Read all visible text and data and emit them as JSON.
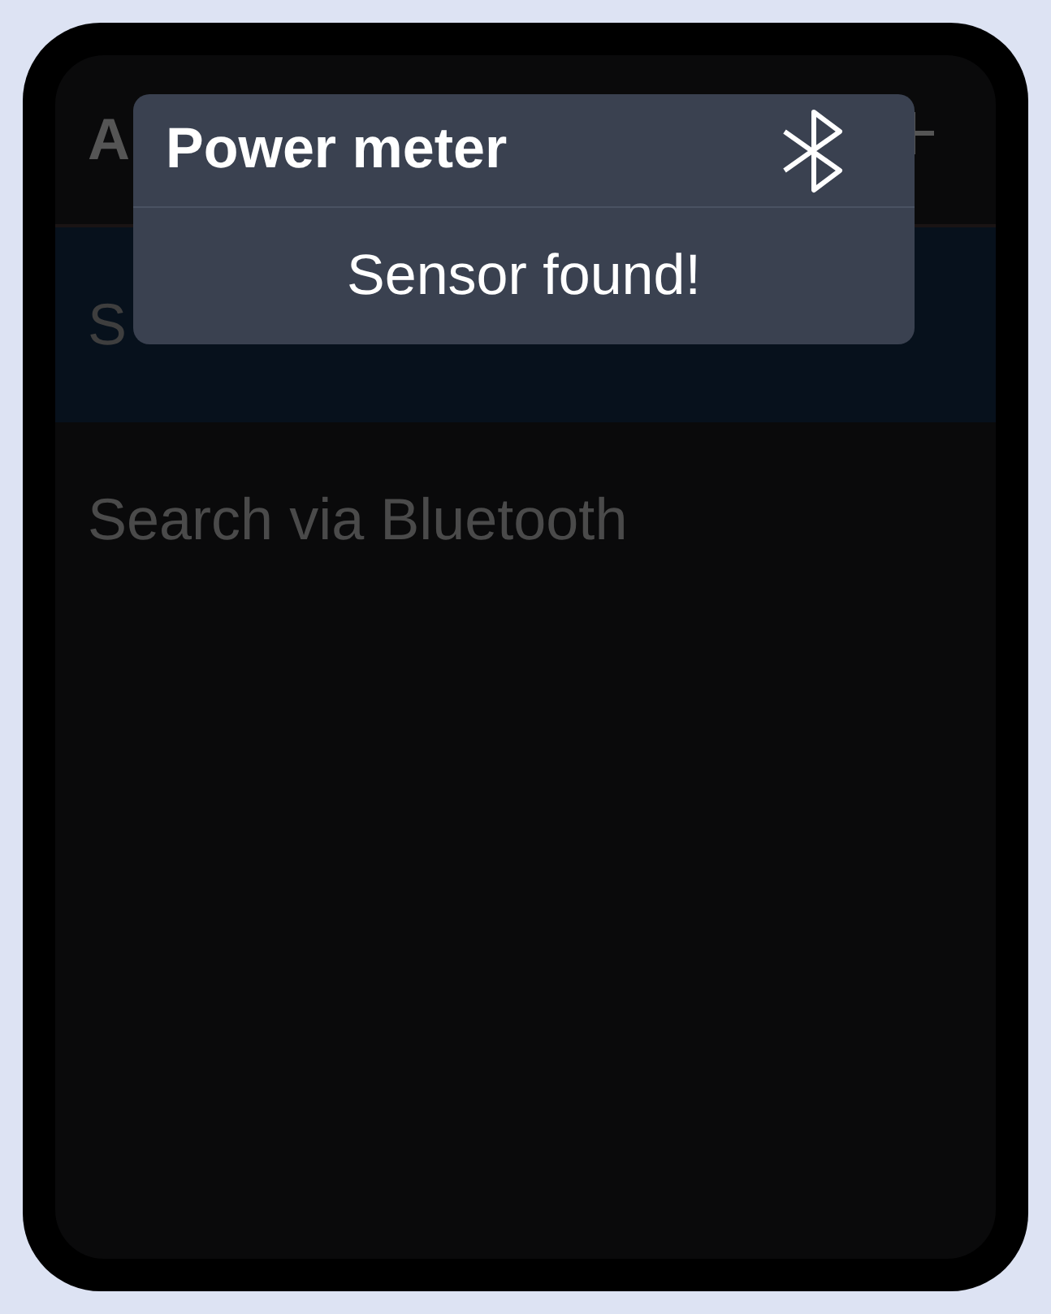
{
  "header": {
    "title": "A"
  },
  "list": [
    {
      "label": "S",
      "selected": true
    },
    {
      "label": "Search via Bluetooth",
      "selected": false
    }
  ],
  "popup": {
    "title": "Power meter",
    "message": "Sensor found!"
  }
}
